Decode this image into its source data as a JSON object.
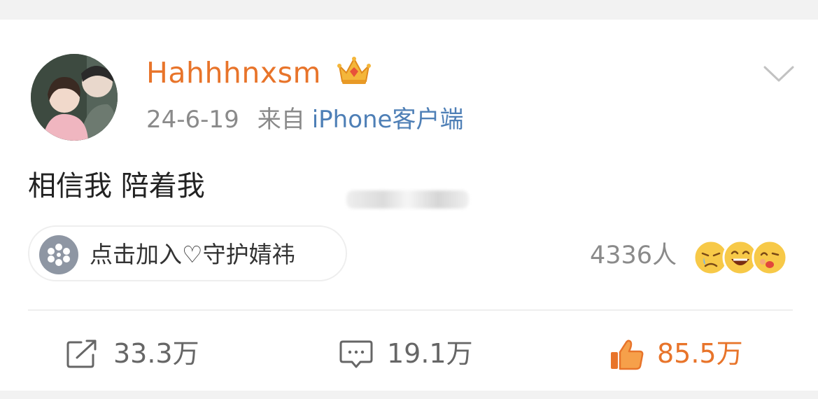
{
  "post": {
    "author": {
      "username": "Hahhhnxsm",
      "badge_icon": "crown-icon",
      "avatar_icon": "avatar-photo"
    },
    "meta": {
      "date": "24-6-19",
      "from_label": "来自",
      "client": "iPhone客户端"
    },
    "text": "相信我 陪着我",
    "group": {
      "icon": "flower-icon",
      "label": "点击加入♡守护婧祎"
    },
    "reactions": {
      "count": "4336人",
      "icons": [
        "sad-face-icon",
        "laughing-face-icon",
        "kissing-face-icon"
      ]
    },
    "actions": {
      "share_count": "33.3万",
      "comment_count": "19.1万",
      "like_count": "85.5万"
    }
  },
  "colors": {
    "username": "#e8742a",
    "client_link": "#4e7fb6",
    "like_active": "#e8742a",
    "meta_gray": "#8a8a8a"
  }
}
